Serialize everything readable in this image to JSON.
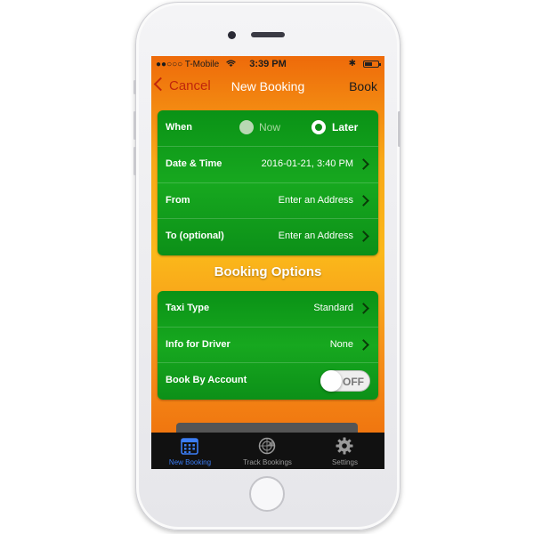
{
  "status_bar": {
    "carrier": "●●○○○ T-Mobile",
    "wifi_icon": "wifi-icon",
    "time": "3:39 PM",
    "bluetooth": "✱"
  },
  "nav": {
    "cancel_label": "Cancel",
    "title": "New Booking",
    "book_label": "Book"
  },
  "booking": {
    "when_label": "When",
    "now_label": "Now",
    "later_label": "Later",
    "selected": "Later",
    "rows": [
      {
        "label": "Date & Time",
        "value": "2016-01-21, 3:40 PM"
      },
      {
        "label": "From",
        "value": "Enter an Address"
      },
      {
        "label": "To (optional)",
        "value": "Enter an Address"
      }
    ]
  },
  "options": {
    "title": "Booking Options",
    "rows": [
      {
        "label": "Taxi Type",
        "value": "Standard"
      },
      {
        "label": "Info for Driver",
        "value": "None"
      }
    ],
    "account_label": "Book By Account",
    "account_toggle": "OFF"
  },
  "tabs": [
    {
      "label": "New Booking",
      "icon": "calendar-icon",
      "active": true
    },
    {
      "label": "Track Bookings",
      "icon": "radar-icon",
      "active": false
    },
    {
      "label": "Settings",
      "icon": "gear-icon",
      "active": false
    }
  ],
  "colors": {
    "orange": "#ee6a0a",
    "yellow": "#fbb81a",
    "green": "#17a81f",
    "cancel_red": "#c0260c",
    "tab_active": "#3b7df5"
  }
}
